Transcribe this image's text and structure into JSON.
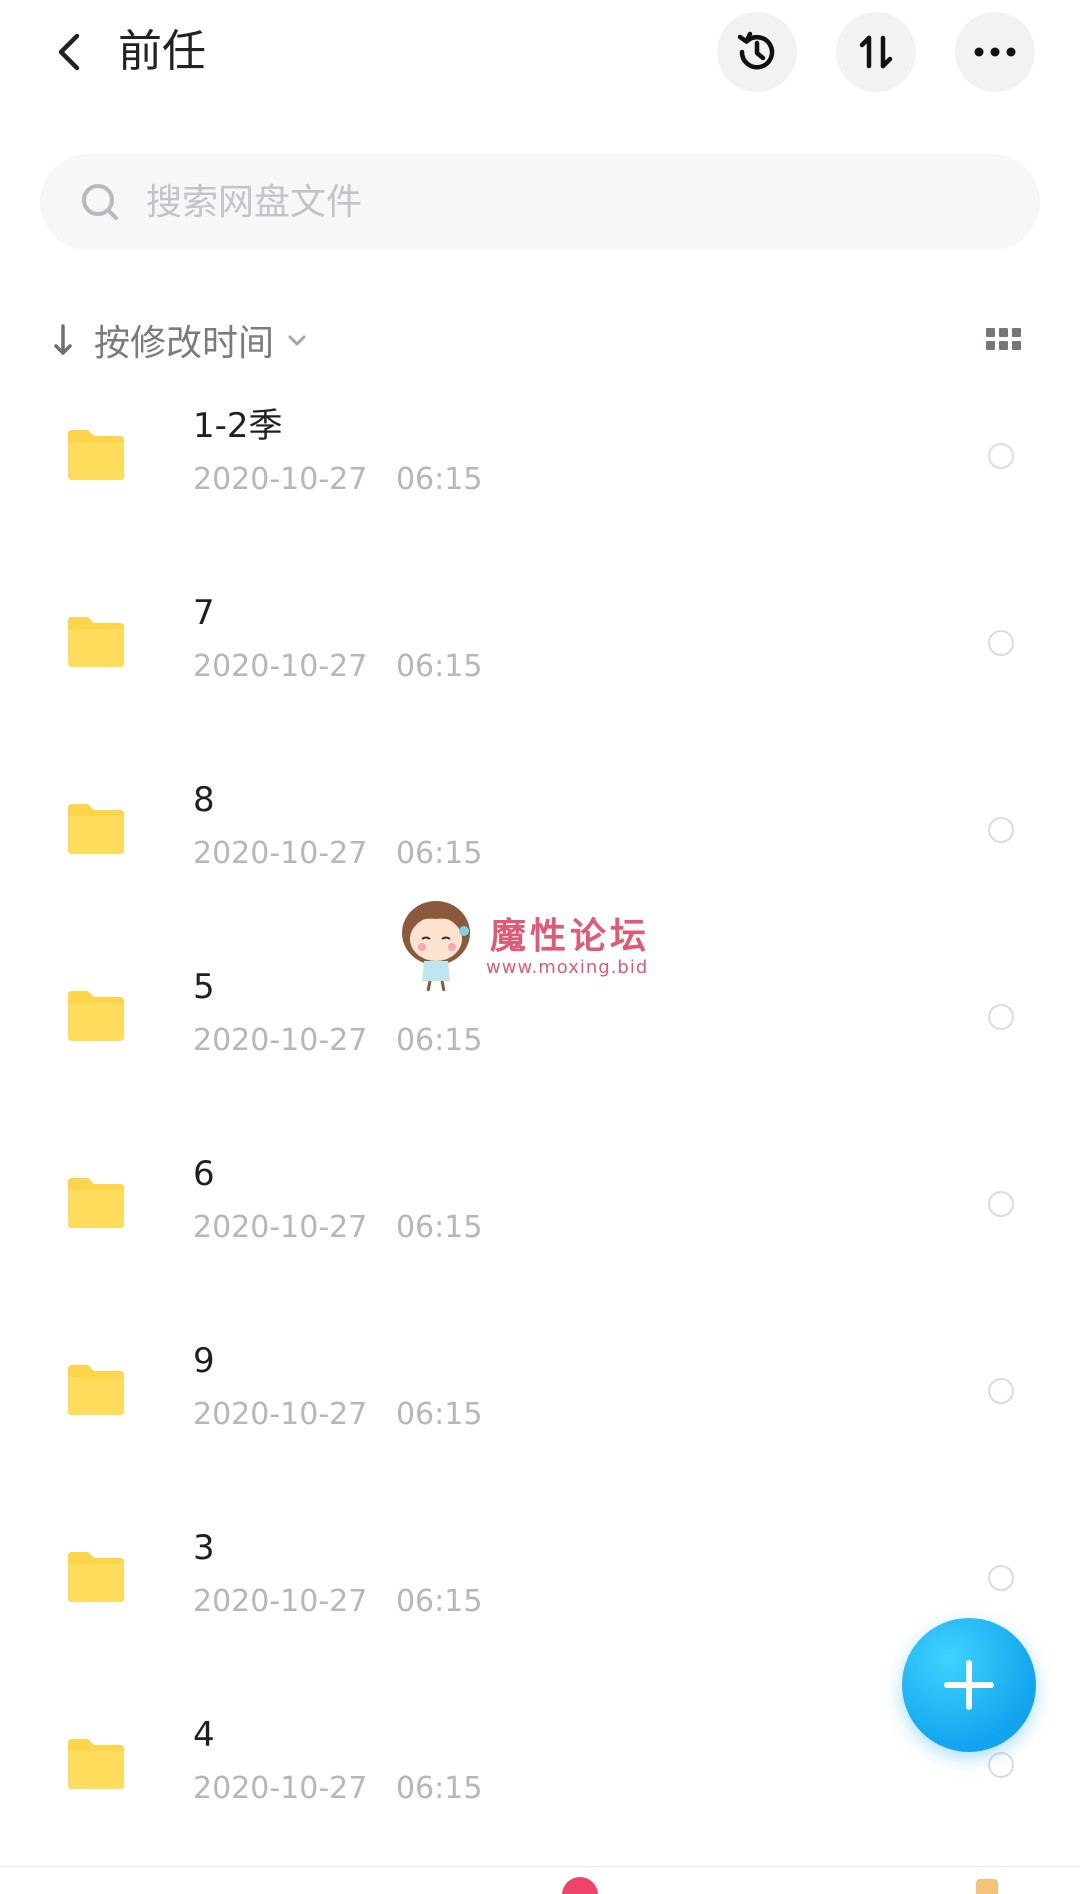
{
  "header": {
    "title": "前任",
    "icons": {
      "back": "chevron-left-icon",
      "history": "history-icon",
      "transfer": "transfer-icon",
      "more": "more-icon"
    }
  },
  "search": {
    "placeholder": "搜索网盘文件",
    "icon": "search-icon"
  },
  "sort": {
    "label": "按修改时间",
    "direction": "down"
  },
  "files": [
    {
      "name": "1-2季",
      "time": "2020-10-27   06:15"
    },
    {
      "name": "7",
      "time": "2020-10-27   06:15"
    },
    {
      "name": "8",
      "time": "2020-10-27   06:15"
    },
    {
      "name": "5",
      "time": "2020-10-27   06:15"
    },
    {
      "name": "6",
      "time": "2020-10-27   06:15"
    },
    {
      "name": "9",
      "time": "2020-10-27   06:15"
    },
    {
      "name": "3",
      "time": "2020-10-27   06:15"
    },
    {
      "name": "4",
      "time": "2020-10-27   06:15"
    }
  ],
  "watermark": {
    "title": "魔性论坛",
    "url": "www.moxing.bid"
  },
  "colors": {
    "folder": "#fdd44a",
    "fab": "#12a4ee",
    "watermark": "#e05a75",
    "badge": "#f0436b"
  }
}
